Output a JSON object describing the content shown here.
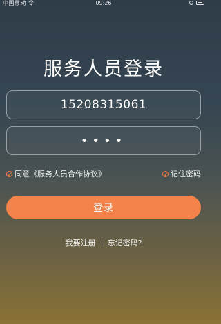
{
  "status_bar": {
    "left": "中国移动 令",
    "time": "09:26"
  },
  "title": "服务人员登录",
  "phone": {
    "value": "15208315061"
  },
  "password": {
    "masked": "••••"
  },
  "agreement": {
    "text": "同意《服务人员合作协议》"
  },
  "remember": {
    "text": "记住密码"
  },
  "login_button": {
    "label": "登录"
  },
  "links": {
    "register": "我要注册",
    "forgot": "忘记密码?"
  },
  "colors": {
    "accent": "#f3834a",
    "check": "#f07a3c"
  }
}
